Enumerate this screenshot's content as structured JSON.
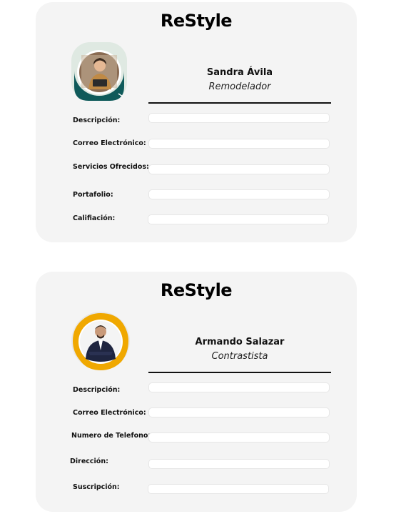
{
  "cards": [
    {
      "brand": "ReStyle",
      "name": "Sandra Ávila",
      "role": "Remodelador",
      "avatar_icon": "profile-photo-woman-with-laptop",
      "accent": "#0f5a5a",
      "fields": [
        {
          "label": "Descripción:",
          "value": ""
        },
        {
          "label": "Correo Electrónico:",
          "value": ""
        },
        {
          "label": "Servicios Ofrecidos:",
          "value": ""
        },
        {
          "label": "Portafolio:",
          "value": ""
        },
        {
          "label": "Califiación:",
          "value": ""
        }
      ]
    },
    {
      "brand": "ReStyle",
      "name": "Armando Salazar",
      "role": "Contrastista",
      "avatar_icon": "profile-photo-man-in-suit",
      "accent": "#f0a800",
      "fields": [
        {
          "label": "Descripción:",
          "value": ""
        },
        {
          "label": "Correo Electrónico:",
          "value": ""
        },
        {
          "label": "Numero de Telefono:",
          "value": ""
        },
        {
          "label": "Dirección:",
          "value": ""
        },
        {
          "label": "Suscripción:",
          "value": ""
        }
      ]
    }
  ]
}
